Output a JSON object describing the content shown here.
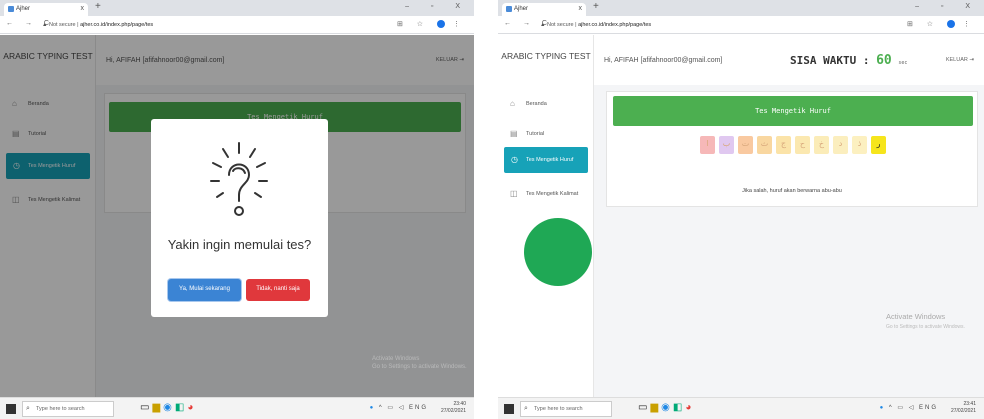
{
  "browser": {
    "tab_title": "Ajher",
    "tab_close": "x",
    "new_tab": "+",
    "nav_icons": "← → C",
    "security": "▲ Not secure",
    "url1": "ajher.co.id/index.php/page/tes",
    "url2": "ajher.co.id/index.php/page/tes",
    "window_controls": "– ▫ X",
    "right_icons": "⊞ ☆"
  },
  "app": {
    "brand": "ARABIC TYPING TEST",
    "greeting": "Hi, AFIFAH [afifahnoor00@gmail.com]",
    "logout": "KELUAR",
    "menu": [
      {
        "label": "Beranda",
        "icon": "⌂"
      },
      {
        "label": "Tutorial",
        "icon": "▤"
      },
      {
        "label": "Tes Mengetik Huruf",
        "icon": "◷"
      },
      {
        "label": "Tes Mengetik Kalimat",
        "icon": "◫"
      }
    ],
    "test_title": "Tes Mengetik Huruf"
  },
  "modal": {
    "title": "Yakin ingin memulai tes?",
    "yes": "Ya, Mulai sekarang",
    "no": "Tidak, nanti saja"
  },
  "test": {
    "timer_label": "SISA WAKTU :",
    "timer_value": "60",
    "timer_unit": "sec",
    "letters": [
      {
        "char": "ا",
        "bg": "#f6b8b8"
      },
      {
        "char": "ب",
        "bg": "#e0c8f0"
      },
      {
        "char": "ت",
        "bg": "#f9c9a0"
      },
      {
        "char": "ث",
        "bg": "#f9d7a0"
      },
      {
        "char": "ج",
        "bg": "#fbe3a8"
      },
      {
        "char": "ح",
        "bg": "#fbe8b0"
      },
      {
        "char": "خ",
        "bg": "#fbecb8"
      },
      {
        "char": "د",
        "bg": "#fbeebe"
      },
      {
        "char": "ذ",
        "bg": "#fcf0c0"
      },
      {
        "char": "ر",
        "bg": "#f6e51c"
      }
    ],
    "hint": "Jika salah, huruf akan berwarna abu-abu"
  },
  "taskbar": {
    "search": "Type here to search",
    "time1": "23:40",
    "date1": "27/02/2021",
    "time2": "23:41",
    "date2": "27/02/2021",
    "lang": "ENG"
  },
  "watermark": {
    "title": "Activate Windows",
    "sub": "Go to Settings to activate Windows."
  },
  "colors": {
    "green": "#4caf50",
    "teal": "#17a2b8",
    "blue": "#3b84d4",
    "red": "#e0383c"
  }
}
